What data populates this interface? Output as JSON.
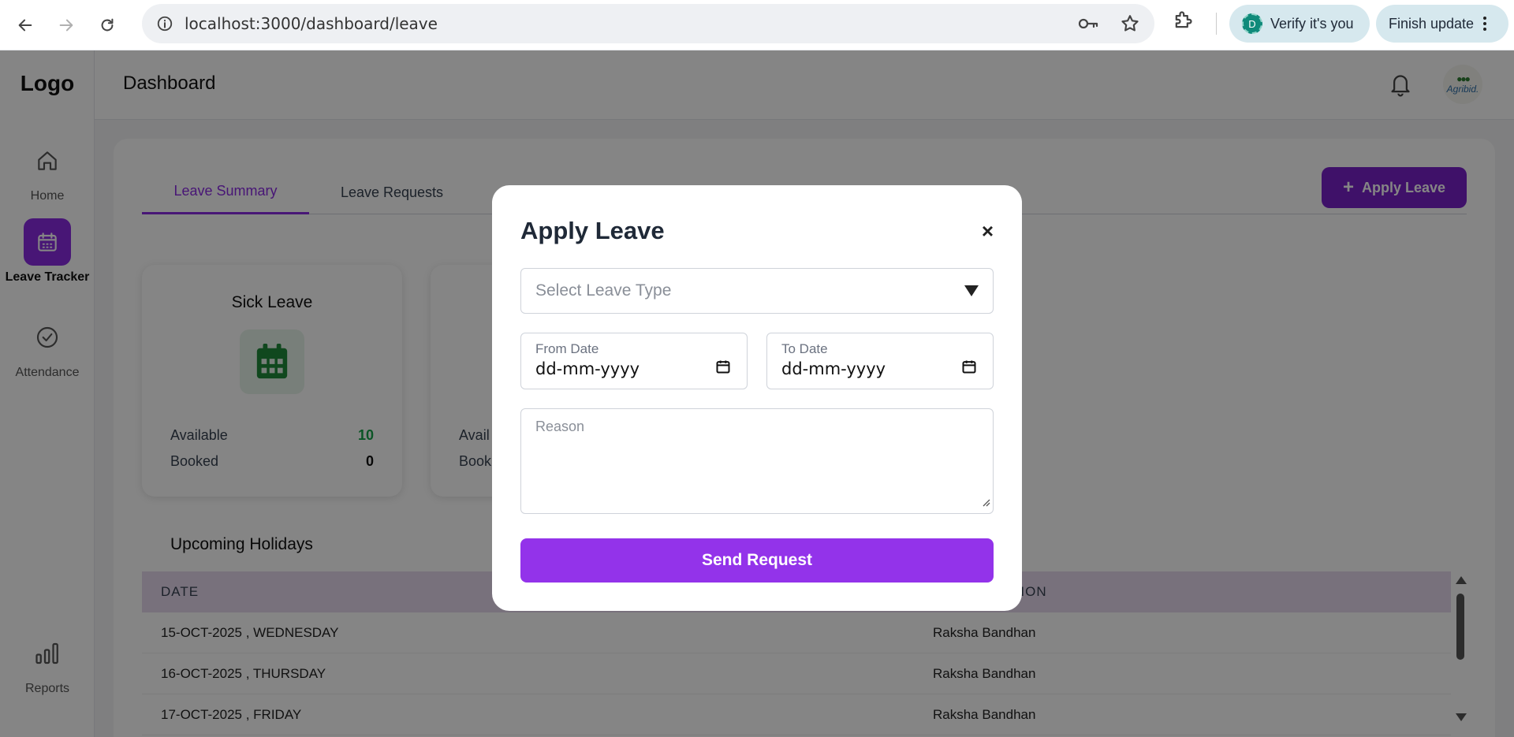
{
  "browser": {
    "url": "localhost:3000/dashboard/leave",
    "verify_label": "Verify it's you",
    "verify_avatar": "D",
    "finish_update_label": "Finish update"
  },
  "sidebar": {
    "logo": "Logo",
    "items": [
      {
        "label": "Home",
        "icon": "home-icon"
      },
      {
        "label": "Leave Tracker",
        "icon": "calendar-icon"
      },
      {
        "label": "Attendance",
        "icon": "check-circle-icon"
      },
      {
        "label": "Reports",
        "icon": "bar-chart-icon"
      }
    ]
  },
  "header": {
    "title": "Dashboard",
    "brand_text": "Agribid."
  },
  "tabs": [
    {
      "label": "Leave Summary",
      "active": true
    },
    {
      "label": "Leave Requests",
      "active": false
    }
  ],
  "apply_leave_button": "Apply Leave",
  "leave_cards": [
    {
      "title": "Sick Leave",
      "available_label": "Available",
      "available": "10",
      "booked_label": "Booked",
      "booked": "0"
    },
    {
      "available_label": "Avail",
      "booked_label": "Book"
    }
  ],
  "holidays": {
    "title": "Upcoming Holidays",
    "columns": [
      "DATE",
      "TION"
    ],
    "rows": [
      {
        "date": "15-OCT-2025 , WEDNESDAY",
        "description": "Raksha Bandhan"
      },
      {
        "date": "16-OCT-2025 , THURSDAY",
        "description": "Raksha Bandhan"
      },
      {
        "date": "17-OCT-2025 , FRIDAY",
        "description": "Raksha Bandhan"
      }
    ]
  },
  "modal": {
    "title": "Apply Leave",
    "close": "×",
    "leave_type_placeholder": "Select Leave Type",
    "from_date_label": "From Date",
    "from_date_value": "dd-mm-yyyy",
    "to_date_label": "To Date",
    "to_date_value": "dd-mm-yyyy",
    "reason_placeholder": "Reason",
    "submit_label": "Send Request"
  },
  "colors": {
    "accent": "#9333ea",
    "accent_dark": "#7a22c9",
    "available_green": "#16a34a",
    "table_header_bg": "#e6d8ee"
  }
}
